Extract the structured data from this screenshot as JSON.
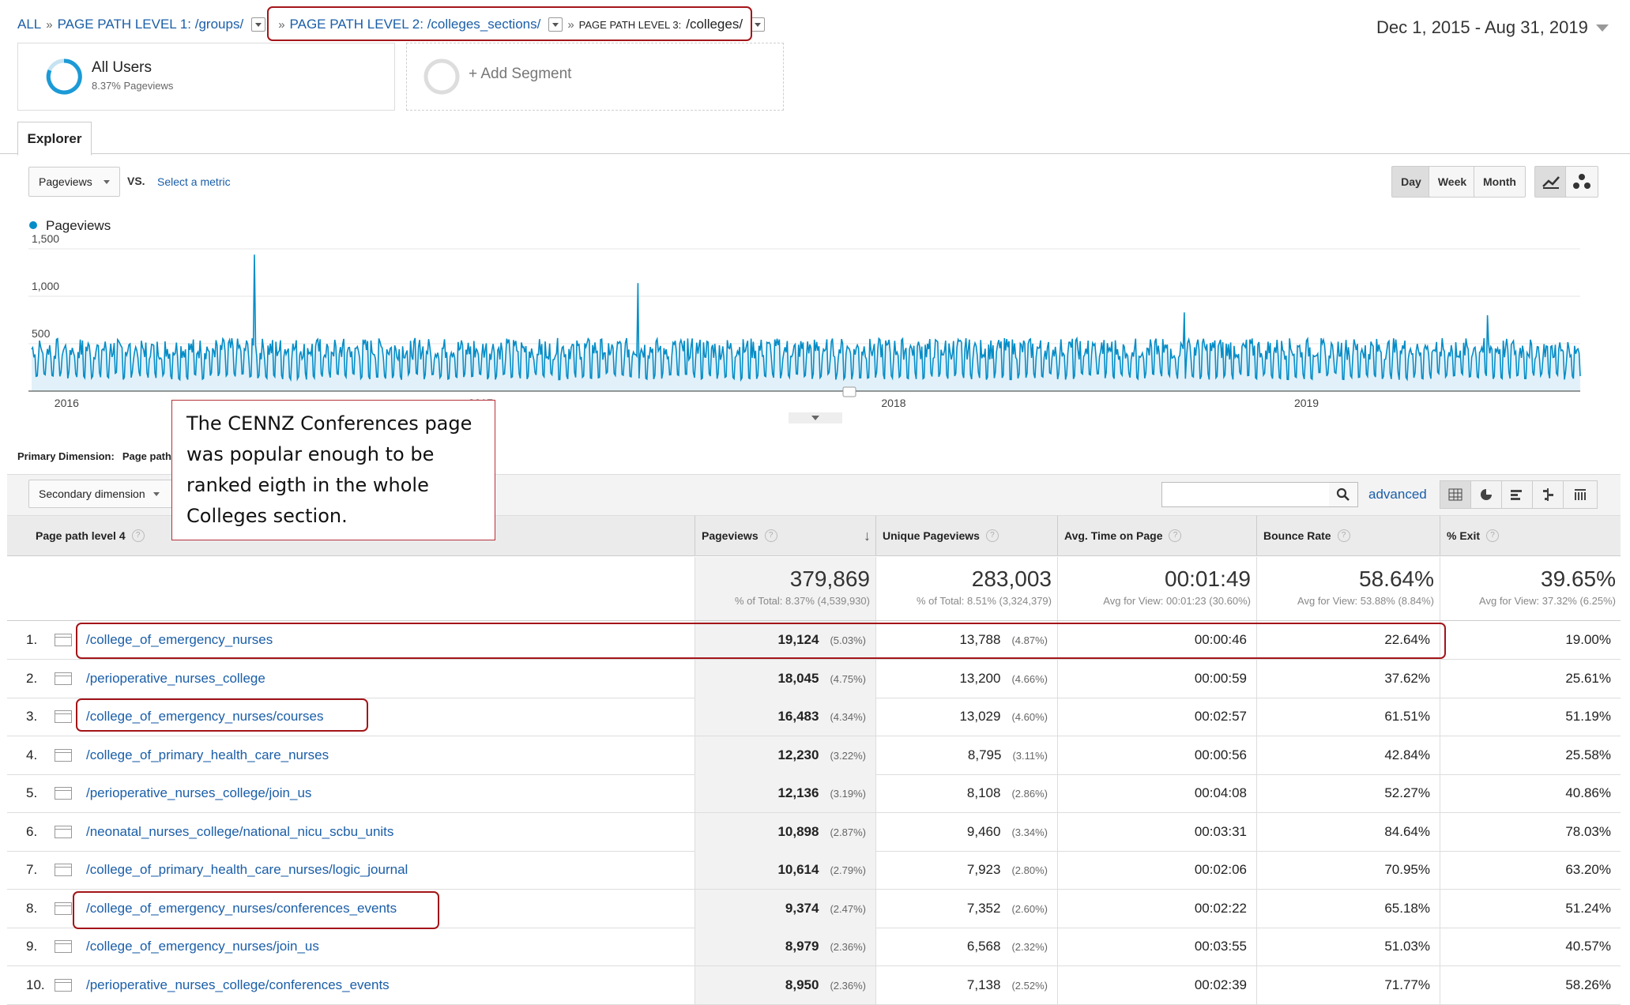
{
  "breadcrumb": {
    "all": "ALL",
    "level1": "PAGE PATH LEVEL 1: /groups/",
    "level2": "PAGE PATH LEVEL 2: /colleges_sections/",
    "level3_label": "PAGE PATH LEVEL 3:",
    "level3_value": "/colleges/"
  },
  "date_range": "Dec 1, 2015 - Aug 31, 2019",
  "segments": {
    "all_users": "All Users",
    "all_users_sub": "8.37% Pageviews",
    "add_segment": "+ Add Segment"
  },
  "tab_explorer": "Explorer",
  "metric_select": "Pageviews",
  "vs": "VS.",
  "select_metric": "Select a metric",
  "period_buttons": [
    "Day",
    "Week",
    "Month"
  ],
  "chart_data": {
    "type": "line",
    "legend": "Pageviews",
    "series_color": "#058dc7",
    "y_ticks": [
      "1,500",
      "1,000",
      "500"
    ],
    "ylim": [
      0,
      1500
    ],
    "x_ticks": [
      "2016",
      "2017",
      "2018",
      "2019"
    ],
    "x_range": [
      "2015-12-01",
      "2019-08-31"
    ],
    "peaks": [
      {
        "date": "2016-06-15",
        "value": 1440
      },
      {
        "date": "2017-05-20",
        "value": 1140
      },
      {
        "date": "2018-09-15",
        "value": 830
      },
      {
        "date": "2019-06-10",
        "value": 800
      }
    ]
  },
  "annotation_text": "The CENNZ Conferences page was popular enough to be ranked eigth in the whole Colleges section.",
  "primary_dimension": "Primary Dimension:",
  "primary_dimension_value": "Page path level 4",
  "secondary_dimension": "Secondary dimension",
  "advanced": "advanced",
  "columns": {
    "dim": "Page path level 4",
    "pageviews": "Pageviews",
    "unique": "Unique Pageviews",
    "avgtime": "Avg. Time on Page",
    "bounce": "Bounce Rate",
    "exit": "% Exit"
  },
  "totals": {
    "pageviews": "379,869",
    "pageviews_sub": "% of Total: 8.37% (4,539,930)",
    "unique": "283,003",
    "unique_sub": "% of Total: 8.51% (3,324,379)",
    "avgtime": "00:01:49",
    "avgtime_sub": "Avg for View: 00:01:23 (30.60%)",
    "bounce": "58.64%",
    "bounce_sub": "Avg for View: 53.88% (8.84%)",
    "exit": "39.65%",
    "exit_sub": "Avg for View: 37.32% (6.25%)"
  },
  "rows": [
    {
      "n": "1.",
      "path": "/college_of_emergency_nurses",
      "pv": "19,124",
      "pvp": "(5.03%)",
      "upv": "13,788",
      "upvp": "(4.87%)",
      "time": "00:00:46",
      "bounce": "22.64%",
      "exit": "19.00%"
    },
    {
      "n": "2.",
      "path": "/perioperative_nurses_college",
      "pv": "18,045",
      "pvp": "(4.75%)",
      "upv": "13,200",
      "upvp": "(4.66%)",
      "time": "00:00:59",
      "bounce": "37.62%",
      "exit": "25.61%"
    },
    {
      "n": "3.",
      "path": "/college_of_emergency_nurses/courses",
      "pv": "16,483",
      "pvp": "(4.34%)",
      "upv": "13,029",
      "upvp": "(4.60%)",
      "time": "00:02:57",
      "bounce": "61.51%",
      "exit": "51.19%"
    },
    {
      "n": "4.",
      "path": "/college_of_primary_health_care_nurses",
      "pv": "12,230",
      "pvp": "(3.22%)",
      "upv": "8,795",
      "upvp": "(3.11%)",
      "time": "00:00:56",
      "bounce": "42.84%",
      "exit": "25.58%"
    },
    {
      "n": "5.",
      "path": "/perioperative_nurses_college/join_us",
      "pv": "12,136",
      "pvp": "(3.19%)",
      "upv": "8,108",
      "upvp": "(2.86%)",
      "time": "00:04:08",
      "bounce": "52.27%",
      "exit": "40.86%"
    },
    {
      "n": "6.",
      "path": "/neonatal_nurses_college/national_nicu_scbu_units",
      "pv": "10,898",
      "pvp": "(2.87%)",
      "upv": "9,460",
      "upvp": "(3.34%)",
      "time": "00:03:31",
      "bounce": "84.64%",
      "exit": "78.03%"
    },
    {
      "n": "7.",
      "path": "/college_of_primary_health_care_nurses/logic_journal",
      "pv": "10,614",
      "pvp": "(2.79%)",
      "upv": "7,923",
      "upvp": "(2.80%)",
      "time": "00:02:06",
      "bounce": "70.95%",
      "exit": "63.20%"
    },
    {
      "n": "8.",
      "path": "/college_of_emergency_nurses/conferences_events",
      "pv": "9,374",
      "pvp": "(2.47%)",
      "upv": "7,352",
      "upvp": "(2.60%)",
      "time": "00:02:22",
      "bounce": "65.18%",
      "exit": "51.24%"
    },
    {
      "n": "9.",
      "path": "/college_of_emergency_nurses/join_us",
      "pv": "8,979",
      "pvp": "(2.36%)",
      "upv": "6,568",
      "upvp": "(2.32%)",
      "time": "00:03:55",
      "bounce": "51.03%",
      "exit": "40.57%"
    },
    {
      "n": "10.",
      "path": "/perioperative_nurses_college/conferences_events",
      "pv": "8,950",
      "pvp": "(2.36%)",
      "upv": "7,138",
      "upvp": "(2.52%)",
      "time": "00:02:39",
      "bounce": "71.77%",
      "exit": "58.26%"
    }
  ]
}
